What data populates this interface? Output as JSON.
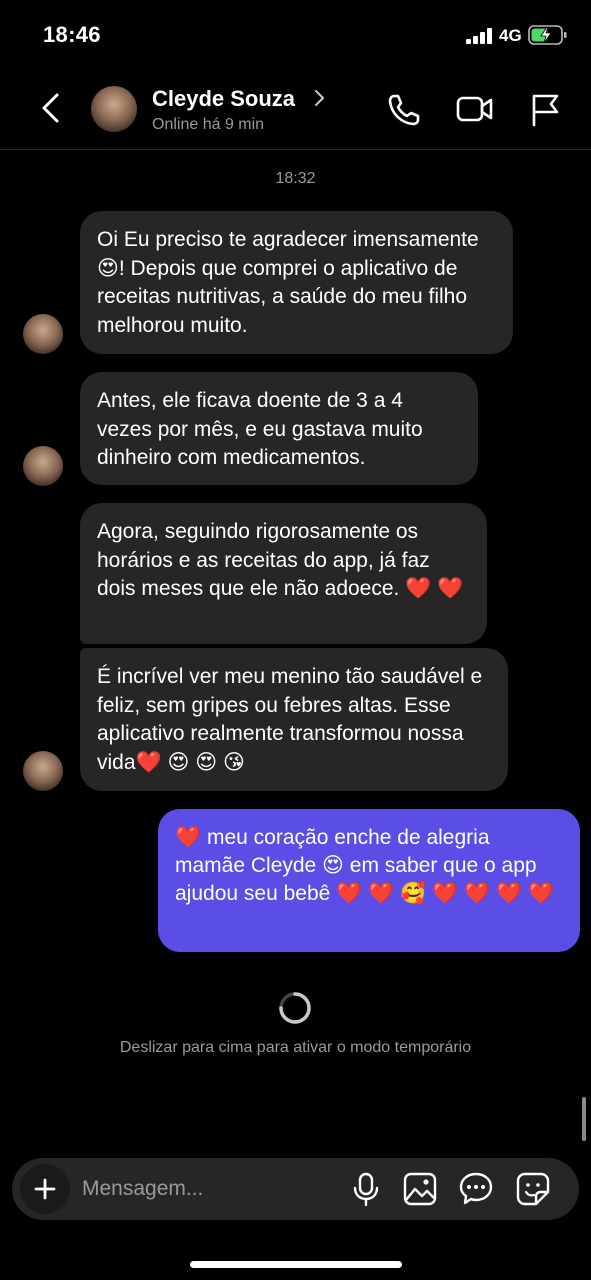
{
  "status_bar": {
    "time": "18:46",
    "network": "4G"
  },
  "header": {
    "contact_name": "Cleyde Souza",
    "contact_status": "Online há 9 min"
  },
  "chat": {
    "timestamp": "18:32",
    "messages": [
      {
        "from": "contact",
        "text": "Oi Eu preciso te agradecer imensamente😍! Depois que comprei o aplicativo de receitas nutritivas, a saúde do meu filho melhorou muito."
      },
      {
        "from": "contact",
        "text": "Antes, ele ficava doente de 3 a 4 vezes por mês, e eu gastava muito dinheiro com medicamentos."
      },
      {
        "from": "contact",
        "text": "Agora, seguindo rigorosamente os horários e as receitas do app, já faz dois meses que ele não adoece. ❤️ ❤️"
      },
      {
        "from": "contact",
        "text": "É incrível ver meu menino tão saudável e feliz, sem gripes ou febres altas. Esse aplicativo realmente transformou nossa vida❤️ 😍 😍 😘"
      },
      {
        "from": "me",
        "text": "❤️  meu coração enche de alegria mamãe Cleyde 😍  em saber que o app ajudou seu bebê ❤️ ❤️ 🥰 ❤️ ❤️ ❤️ ❤️"
      }
    ],
    "temporary_mode_hint": "Deslizar para cima para ativar o modo temporário"
  },
  "composer": {
    "placeholder": "Mensagem..."
  },
  "colors": {
    "background": "#000000",
    "received_bubble": "#262626",
    "sent_bubble": "#5b4ee6",
    "secondary_text": "#9a9a9a",
    "battery_charging": "#4cd964"
  },
  "icons": {
    "back": "chevron-left-icon",
    "call": "phone-icon",
    "video": "video-camera-icon",
    "report": "flag-icon",
    "add": "plus-icon",
    "voice": "microphone-icon",
    "gallery": "image-icon",
    "chat": "chat-bubble-icon",
    "sticker": "sticker-icon"
  }
}
